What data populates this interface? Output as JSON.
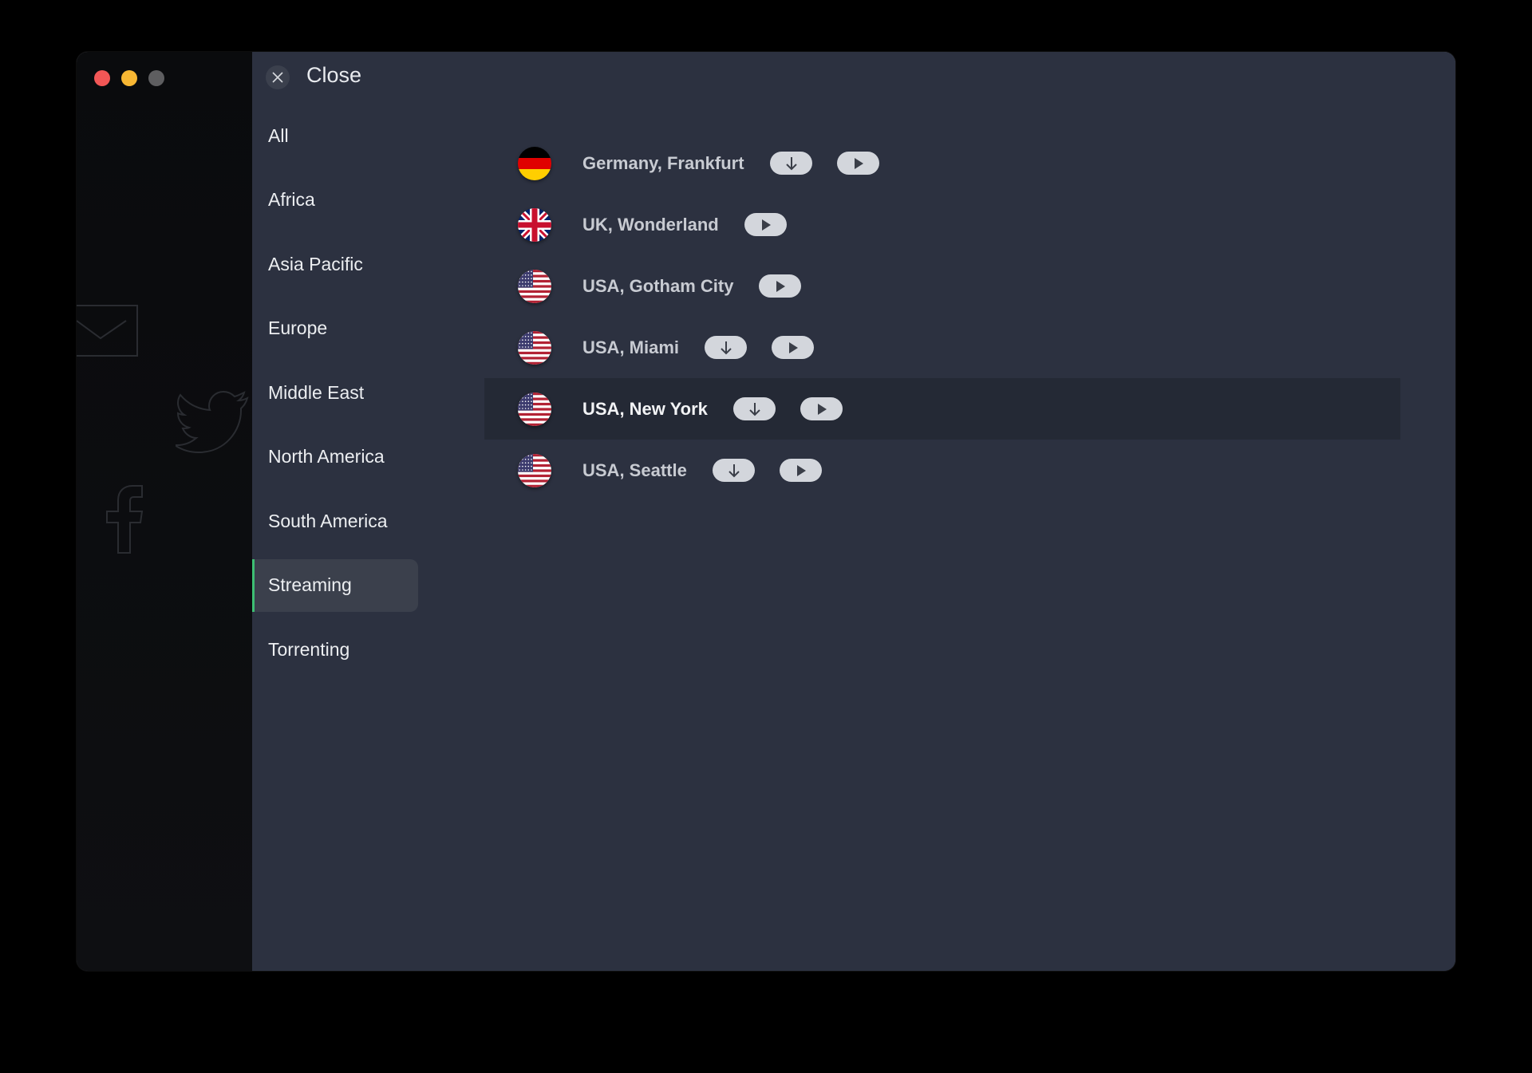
{
  "window": {
    "traffic_lights": [
      {
        "name": "close-window",
        "color": "#f25756"
      },
      {
        "name": "minimize-window",
        "color": "#f8b733"
      },
      {
        "name": "zoom-window",
        "color": "#5e5e60"
      }
    ]
  },
  "background_icons": [
    "envelope-icon",
    "twitter-icon",
    "facebook-icon"
  ],
  "header": {
    "close_icon": "close-icon",
    "close_label": "Close"
  },
  "sidebar": {
    "accent_color": "#3dbf73",
    "items": [
      {
        "label": "All",
        "active": false
      },
      {
        "label": "Africa",
        "active": false
      },
      {
        "label": "Asia Pacific",
        "active": false
      },
      {
        "label": "Europe",
        "active": false
      },
      {
        "label": "Middle East",
        "active": false
      },
      {
        "label": "North America",
        "active": false
      },
      {
        "label": "South America",
        "active": false
      },
      {
        "label": "Streaming",
        "active": true
      },
      {
        "label": "Torrenting",
        "active": false
      }
    ]
  },
  "servers": [
    {
      "label": "Germany, Frankfurt",
      "flag": "germany-flag-icon",
      "download": true,
      "stream": true,
      "hover": false
    },
    {
      "label": "UK, Wonderland",
      "flag": "uk-flag-icon",
      "download": false,
      "stream": true,
      "hover": false
    },
    {
      "label": "USA, Gotham City",
      "flag": "usa-flag-icon",
      "download": false,
      "stream": true,
      "hover": false
    },
    {
      "label": "USA, Miami",
      "flag": "usa-flag-icon",
      "download": true,
      "stream": true,
      "hover": false
    },
    {
      "label": "USA, New York",
      "flag": "usa-flag-icon",
      "download": true,
      "stream": true,
      "hover": true
    },
    {
      "label": "USA, Seattle",
      "flag": "usa-flag-icon",
      "download": true,
      "stream": true,
      "hover": false
    }
  ],
  "action_icons": {
    "download": "download-arrow-icon",
    "stream": "play-icon"
  }
}
